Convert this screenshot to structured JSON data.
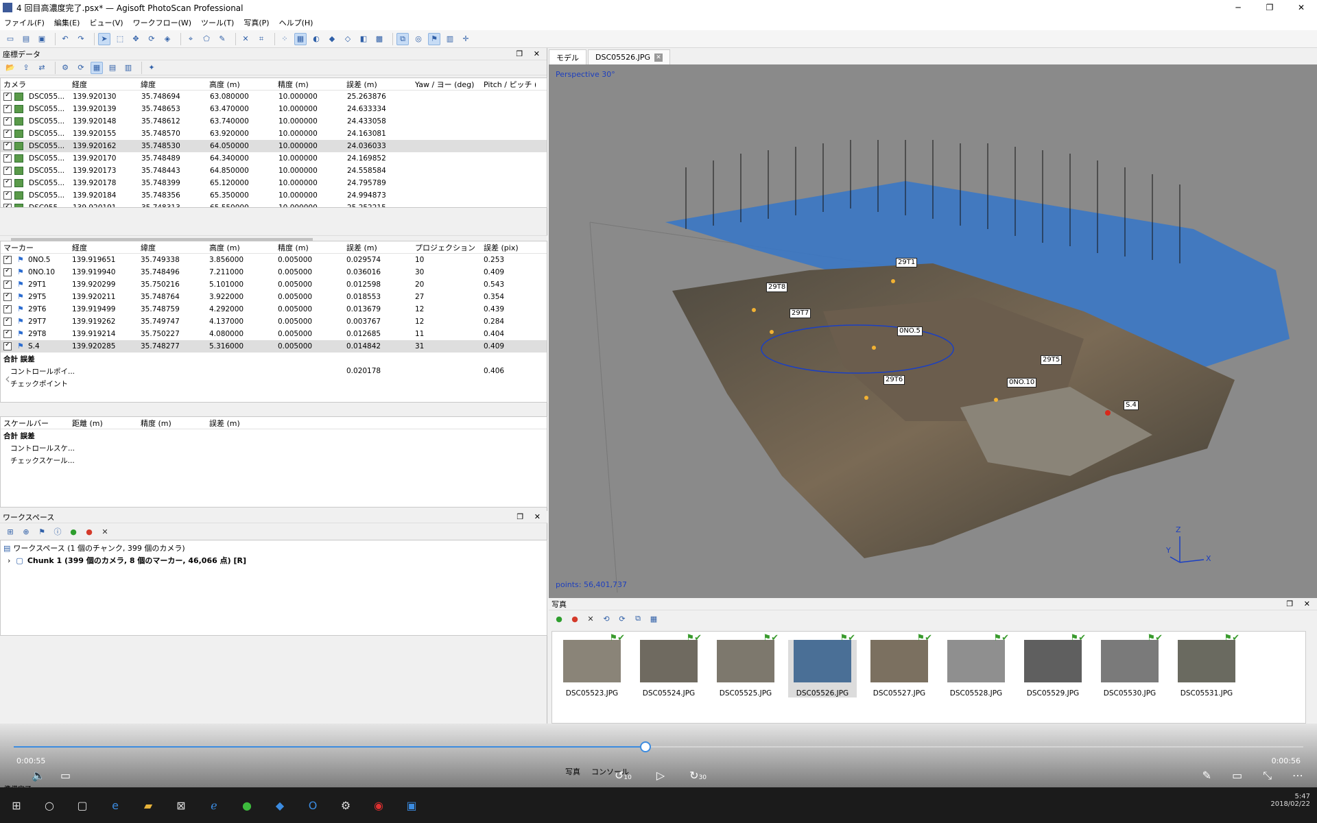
{
  "window": {
    "title": "4 回目高濃度完了.psx* — Agisoft PhotoScan Professional",
    "min": "─",
    "max": "❐",
    "close": "✕"
  },
  "menu": [
    "ファイル(F)",
    "編集(E)",
    "ビュー(V)",
    "ワークフロー(W)",
    "ツール(T)",
    "写真(P)",
    "ヘルプ(H)"
  ],
  "ref_panel": {
    "title": "座標データ"
  },
  "cameras": {
    "headers": [
      "カメラ",
      "経度",
      "緯度",
      "高度 (m)",
      "精度 (m)",
      "誤差 (m)",
      "Yaw / ヨー (deg)",
      "Pitch / ピッチ (d"
    ],
    "rows": [
      [
        "DSC055...",
        "139.920130",
        "35.748694",
        "63.080000",
        "10.000000",
        "25.263876"
      ],
      [
        "DSC055...",
        "139.920139",
        "35.748653",
        "63.470000",
        "10.000000",
        "24.633334"
      ],
      [
        "DSC055...",
        "139.920148",
        "35.748612",
        "63.740000",
        "10.000000",
        "24.433058"
      ],
      [
        "DSC055...",
        "139.920155",
        "35.748570",
        "63.920000",
        "10.000000",
        "24.163081"
      ],
      [
        "DSC055...",
        "139.920162",
        "35.748530",
        "64.050000",
        "10.000000",
        "24.036033"
      ],
      [
        "DSC055...",
        "139.920170",
        "35.748489",
        "64.340000",
        "10.000000",
        "24.169852"
      ],
      [
        "DSC055...",
        "139.920173",
        "35.748443",
        "64.850000",
        "10.000000",
        "24.558584"
      ],
      [
        "DSC055...",
        "139.920178",
        "35.748399",
        "65.120000",
        "10.000000",
        "24.795789"
      ],
      [
        "DSC055...",
        "139.920184",
        "35.748356",
        "65.350000",
        "10.000000",
        "24.994873"
      ],
      [
        "DSC055...",
        "139.920191",
        "35.748313",
        "65.550000",
        "10.000000",
        "25.252215"
      ]
    ],
    "highlight": 4
  },
  "markers": {
    "headers": [
      "マーカー",
      "経度",
      "緯度",
      "高度 (m)",
      "精度 (m)",
      "誤差 (m)",
      "プロジェクション",
      "誤差 (pix)"
    ],
    "rows": [
      [
        "0NO.5",
        "139.919651",
        "35.749338",
        "3.856000",
        "0.005000",
        "0.029574",
        "10",
        "0.253"
      ],
      [
        "0NO.10",
        "139.919940",
        "35.748496",
        "7.211000",
        "0.005000",
        "0.036016",
        "30",
        "0.409"
      ],
      [
        "29T1",
        "139.920299",
        "35.750216",
        "5.101000",
        "0.005000",
        "0.012598",
        "20",
        "0.543"
      ],
      [
        "29T5",
        "139.920211",
        "35.748764",
        "3.922000",
        "0.005000",
        "0.018553",
        "27",
        "0.354"
      ],
      [
        "29T6",
        "139.919499",
        "35.748759",
        "4.292000",
        "0.005000",
        "0.013679",
        "12",
        "0.439"
      ],
      [
        "29T7",
        "139.919262",
        "35.749747",
        "4.137000",
        "0.005000",
        "0.003767",
        "12",
        "0.284"
      ],
      [
        "29T8",
        "139.919214",
        "35.750227",
        "4.080000",
        "0.005000",
        "0.012685",
        "11",
        "0.404"
      ],
      [
        "S.4",
        "139.920285",
        "35.748277",
        "5.316000",
        "0.005000",
        "0.014842",
        "31",
        "0.409"
      ]
    ],
    "highlight": 7,
    "total_label": "合計 誤差",
    "control_label": "コントロールポイ...",
    "control_err": "0.020178",
    "control_pix": "0.406",
    "check_label": "チェックポイント"
  },
  "scalebars": {
    "headers": [
      "スケールバー",
      "距離 (m)",
      "精度 (m)",
      "誤差 (m)"
    ],
    "total_label": "合計 誤差",
    "control_label": "コントロールスケ...",
    "check_label": "チェックスケール..."
  },
  "workspace": {
    "title": "ワークスペース",
    "root": "ワークスペース (1 個のチャンク, 399 個のカメラ)",
    "chunk": "Chunk 1 (399 個のカメラ, 8 個のマーカー, 46,066 点) [R]"
  },
  "tabs": {
    "model": "モデル",
    "photo": "DSC05526.JPG"
  },
  "viewport": {
    "projection": "Perspective 30°",
    "points": "points: 56,401,737",
    "markers": [
      {
        "label": "29T1"
      },
      {
        "label": "29T8"
      },
      {
        "label": "29T7"
      },
      {
        "label": "0NO.5"
      },
      {
        "label": "29T5"
      },
      {
        "label": "29T6"
      },
      {
        "label": "0NO.10"
      },
      {
        "label": "S.4"
      }
    ],
    "axes": {
      "z": "Z",
      "y": "Y",
      "x": "X"
    }
  },
  "photos": {
    "title": "写真",
    "items": [
      "DSC05523.JPG",
      "DSC05524.JPG",
      "DSC05525.JPG",
      "DSC05526.JPG",
      "DSC05527.JPG",
      "DSC05528.JPG",
      "DSC05529.JPG",
      "DSC05530.JPG",
      "DSC05531.JPG"
    ],
    "selected": 3,
    "bottom_tabs": [
      "写真",
      "コンソール"
    ]
  },
  "media": {
    "elapsed": "0:00:55",
    "remaining": "0:00:56",
    "progress": 0.49,
    "skip_back": "10",
    "skip_fwd": "30"
  },
  "status": {
    "text": "準備完了"
  },
  "taskbar": {
    "time": "5:47",
    "date": "2018/02/22"
  }
}
